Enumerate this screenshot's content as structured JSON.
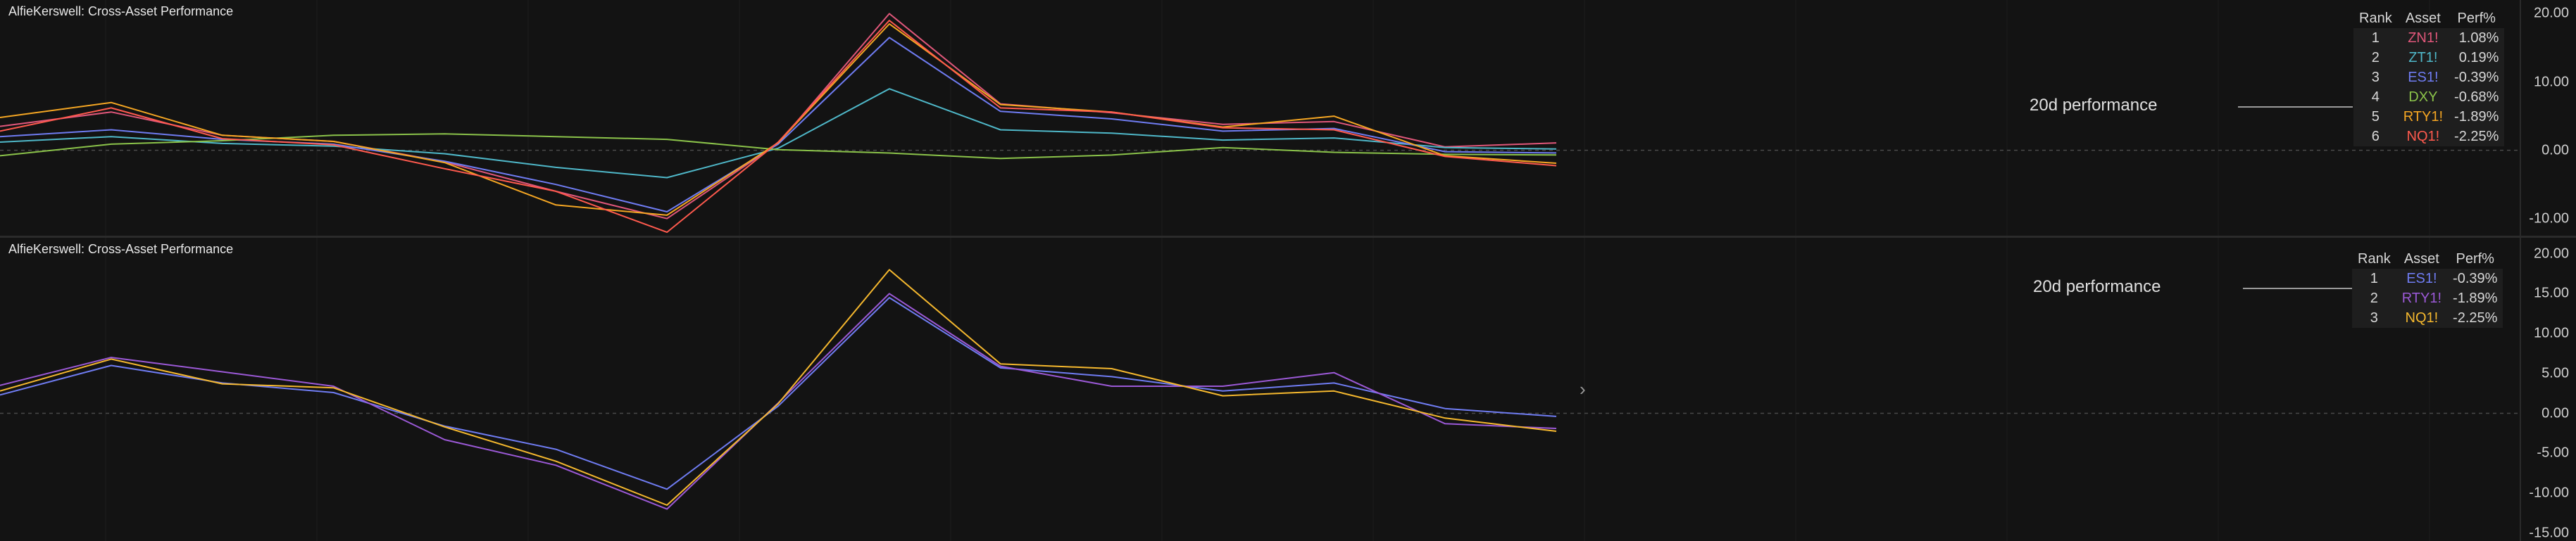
{
  "panes": [
    {
      "title": "AlfieKerswell: Cross-Asset Performance",
      "perf_label": "20d performance",
      "table": {
        "headers": [
          "Rank",
          "Asset",
          "Perf%"
        ],
        "rows": [
          {
            "rank": "1",
            "asset": "ZN1!",
            "perf": "1.08%",
            "color": "#e0577a"
          },
          {
            "rank": "2",
            "asset": "ZT1!",
            "perf": "0.19%",
            "color": "#4fb8c9"
          },
          {
            "rank": "3",
            "asset": "ES1!",
            "perf": "-0.39%",
            "color": "#6f7cf2"
          },
          {
            "rank": "4",
            "asset": "DXY",
            "perf": "-0.68%",
            "color": "#8bc34a"
          },
          {
            "rank": "5",
            "asset": "RTY1!",
            "perf": "-1.89%",
            "color": "#f5a623"
          },
          {
            "rank": "6",
            "asset": "NQ1!",
            "perf": "-2.25%",
            "color": "#ff5a4e"
          }
        ]
      }
    },
    {
      "title": "AlfieKerswell: Cross-Asset Performance",
      "perf_label": "20d performance",
      "table": {
        "headers": [
          "Rank",
          "Asset",
          "Perf%"
        ],
        "rows": [
          {
            "rank": "1",
            "asset": "ES1!",
            "perf": "-0.39%",
            "color": "#6f7cf2"
          },
          {
            "rank": "2",
            "asset": "RTY1!",
            "perf": "-1.89%",
            "color": "#9b59d6"
          },
          {
            "rank": "3",
            "asset": "NQ1!",
            "perf": "-2.25%",
            "color": "#f5b82e"
          }
        ]
      }
    }
  ],
  "chart_data": [
    {
      "type": "line",
      "title": "AlfieKerswell: Cross-Asset Performance",
      "ylim": [
        -12.5,
        22
      ],
      "yticks": [
        "20.00",
        "10.00",
        "0.00",
        "-10.00"
      ],
      "zero_line": true,
      "n_points": 15,
      "series": [
        {
          "name": "ZN1!",
          "color": "#e0577a",
          "values": [
            3.5,
            5.6,
            2.2,
            1.3,
            -1.7,
            -6.0,
            -10.0,
            1.0,
            20.0,
            6.8,
            5.5,
            3.8,
            4.2,
            0.5,
            1.08
          ]
        },
        {
          "name": "ZT1!",
          "color": "#4fb8c9",
          "values": [
            1.2,
            2.0,
            1.0,
            0.6,
            -0.5,
            -2.5,
            -4.0,
            0.3,
            9.0,
            3.0,
            2.5,
            1.5,
            1.8,
            0.4,
            0.19
          ]
        },
        {
          "name": "ES1!",
          "color": "#6f7cf2",
          "values": [
            2.0,
            3.0,
            1.6,
            0.9,
            -1.6,
            -5.0,
            -9.0,
            0.9,
            16.5,
            5.7,
            4.6,
            2.8,
            3.2,
            -0.2,
            -0.39
          ]
        },
        {
          "name": "DXY",
          "color": "#8bc34a",
          "values": [
            -0.8,
            0.9,
            1.4,
            2.2,
            2.4,
            2.0,
            1.6,
            0.1,
            -0.4,
            -1.2,
            -0.7,
            0.4,
            -0.3,
            -0.6,
            -0.68
          ]
        },
        {
          "name": "RTY1!",
          "color": "#f5a623",
          "values": [
            4.8,
            7.0,
            2.2,
            1.3,
            -1.8,
            -8.0,
            -9.5,
            1.1,
            18.5,
            6.7,
            5.6,
            3.4,
            5.0,
            -0.8,
            -1.89
          ]
        },
        {
          "name": "NQ1!",
          "color": "#ff5a4e",
          "values": [
            2.8,
            6.2,
            1.7,
            0.8,
            -2.7,
            -6.0,
            -12.0,
            1.2,
            19.0,
            6.2,
            5.6,
            3.3,
            3.0,
            -0.9,
            -2.25
          ]
        }
      ]
    },
    {
      "type": "line",
      "title": "AlfieKerswell: Cross-Asset Performance",
      "ylim": [
        -16,
        22
      ],
      "yticks": [
        "20.00",
        "15.00",
        "10.00",
        "5.00",
        "0.00",
        "-5.00",
        "-10.00",
        "-15.00"
      ],
      "zero_line": true,
      "n_points": 15,
      "series": [
        {
          "name": "ES1!",
          "color": "#6f7cf2",
          "values": [
            2.3,
            6.0,
            3.8,
            2.6,
            -1.6,
            -4.5,
            -9.5,
            0.9,
            14.5,
            5.7,
            4.6,
            2.8,
            3.8,
            0.6,
            -0.39
          ]
        },
        {
          "name": "RTY1!",
          "color": "#9b59d6",
          "values": [
            3.5,
            7.0,
            5.2,
            3.4,
            -3.3,
            -6.5,
            -12.0,
            1.3,
            15.0,
            5.9,
            3.4,
            3.4,
            5.1,
            -1.3,
            -1.89
          ]
        },
        {
          "name": "NQ1!",
          "color": "#f5b82e",
          "values": [
            2.8,
            6.8,
            3.7,
            3.2,
            -1.7,
            -6.0,
            -11.5,
            1.2,
            18.0,
            6.2,
            5.6,
            2.2,
            2.8,
            -0.6,
            -2.25
          ]
        }
      ]
    }
  ]
}
